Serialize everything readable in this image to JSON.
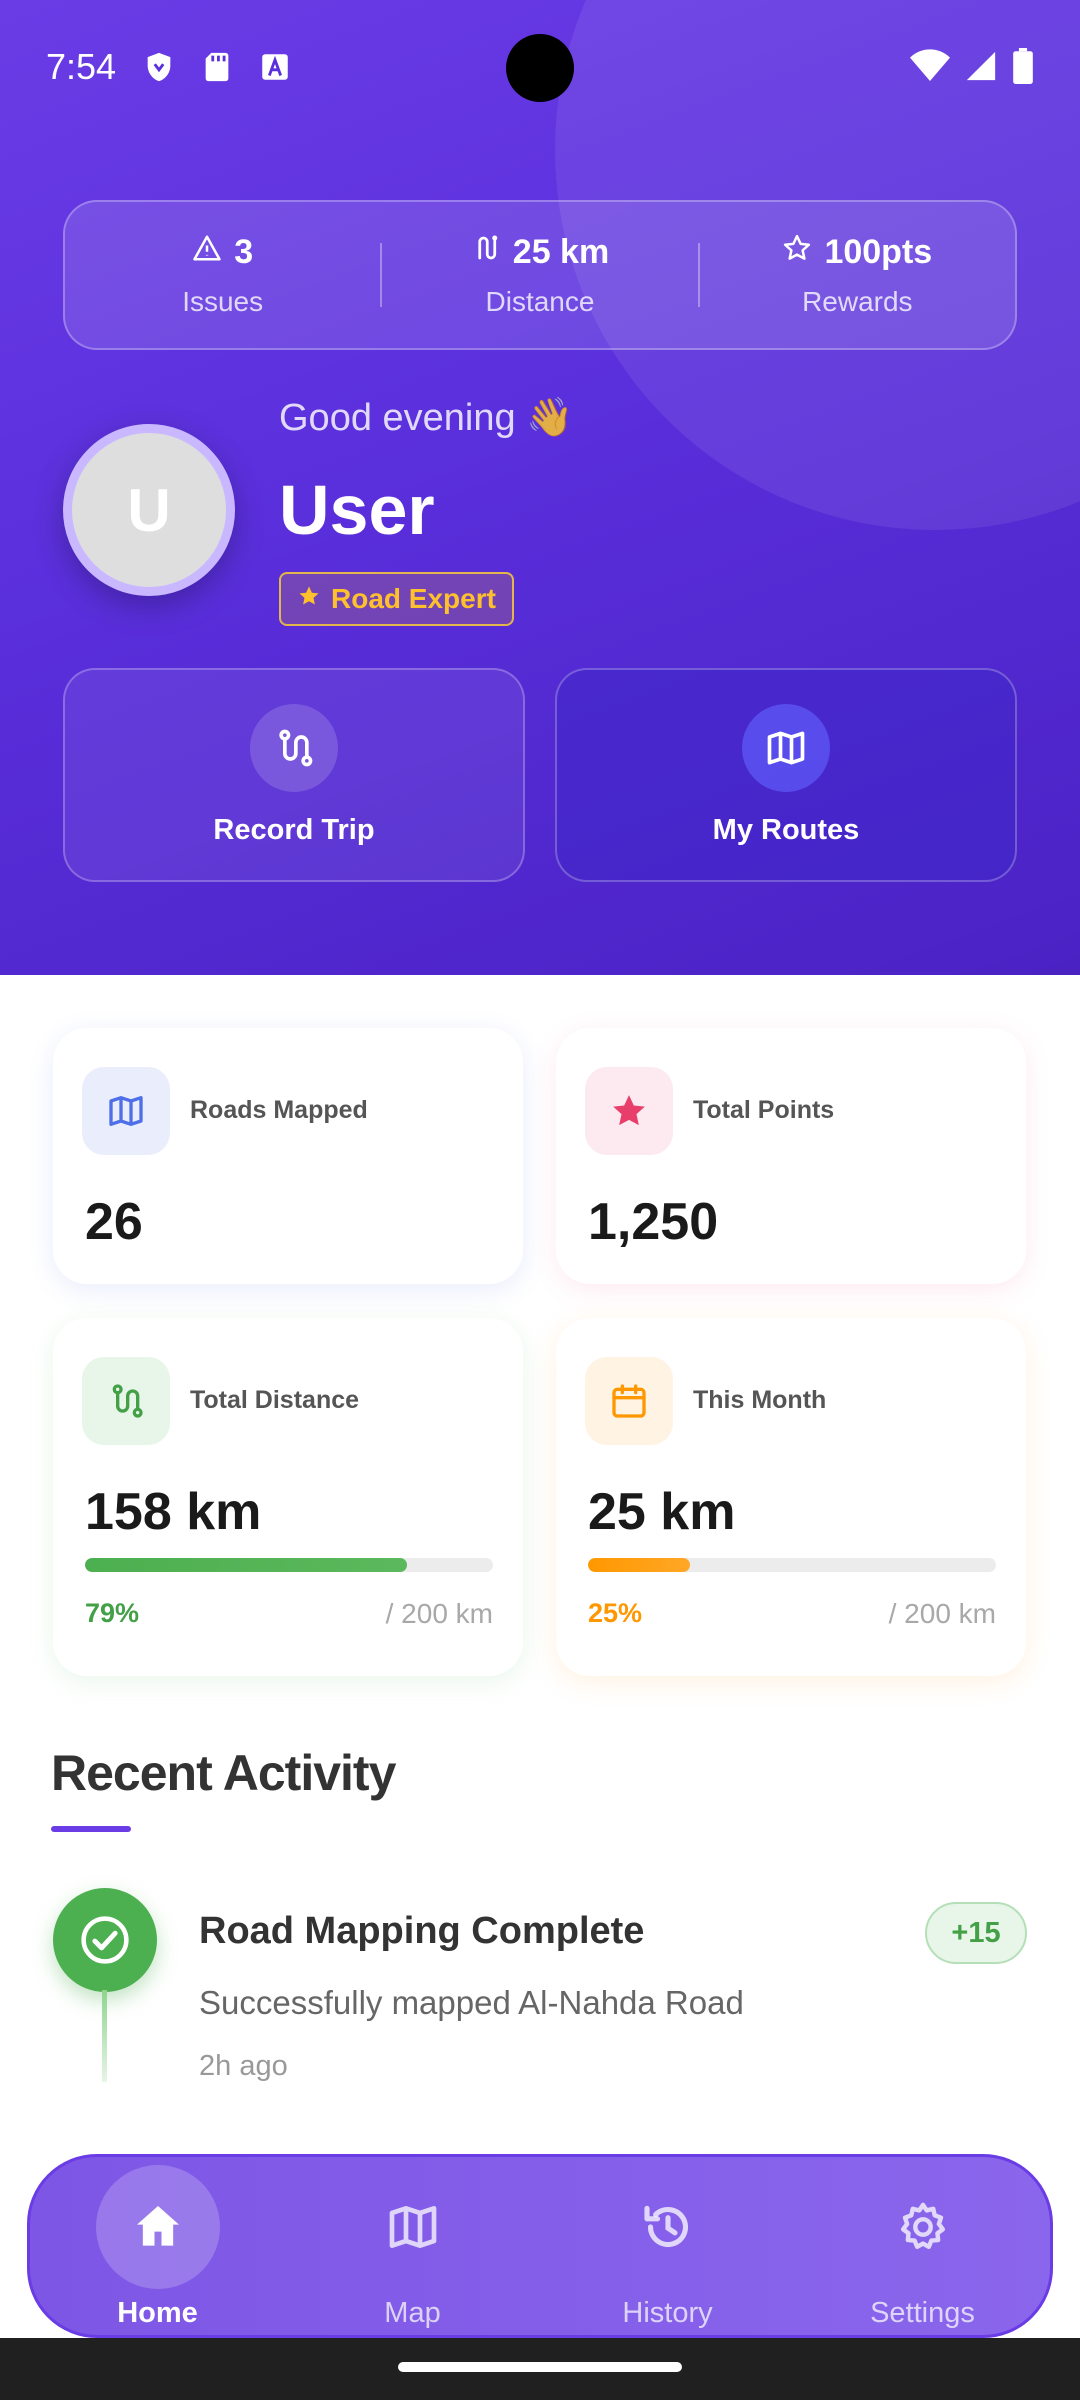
{
  "status_bar": {
    "time": "7:54"
  },
  "header_stats": [
    {
      "value": "3",
      "label": "Issues",
      "icon": "warning-triangle-icon"
    },
    {
      "value": "25 km",
      "label": "Distance",
      "icon": "route-icon"
    },
    {
      "value": "100pts",
      "label": "Rewards",
      "icon": "star-outline-icon"
    }
  ],
  "profile": {
    "avatar_initial": "U",
    "greeting": "Good evening 👋",
    "name": "User",
    "badge": "Road Expert"
  },
  "quick_actions": [
    {
      "label": "Record Trip",
      "icon": "route-icon"
    },
    {
      "label": "My Routes",
      "icon": "map-icon"
    }
  ],
  "cards": {
    "roads_mapped": {
      "label": "Roads Mapped",
      "value": "26",
      "icon": "map-icon",
      "color": "#4f6fe8"
    },
    "total_points": {
      "label": "Total Points",
      "value": "1,250",
      "icon": "star-icon",
      "color": "#e83e6c"
    },
    "total_distance": {
      "label": "Total Distance",
      "value": "158 km",
      "percent_text": "79%",
      "goal": "/ 200 km",
      "progress": 0.79,
      "icon": "route-icon",
      "color": "#43a047"
    },
    "this_month": {
      "label": "This Month",
      "value": "25 km",
      "percent_text": "25%",
      "goal": "/ 200 km",
      "progress": 0.25,
      "icon": "calendar-icon",
      "color": "#ff9800"
    }
  },
  "recent_activity": {
    "title": "Recent Activity",
    "items": [
      {
        "title": "Road Mapping Complete",
        "description": "Successfully mapped Al-Nahda Road",
        "time": "2h ago",
        "points": "+15",
        "icon": "check-circle-icon"
      }
    ]
  },
  "bottom_nav": [
    {
      "label": "Home",
      "icon": "home-icon",
      "active": true
    },
    {
      "label": "Map",
      "icon": "map-icon",
      "active": false
    },
    {
      "label": "History",
      "icon": "history-icon",
      "active": false
    },
    {
      "label": "Settings",
      "icon": "gear-icon",
      "active": false
    }
  ]
}
